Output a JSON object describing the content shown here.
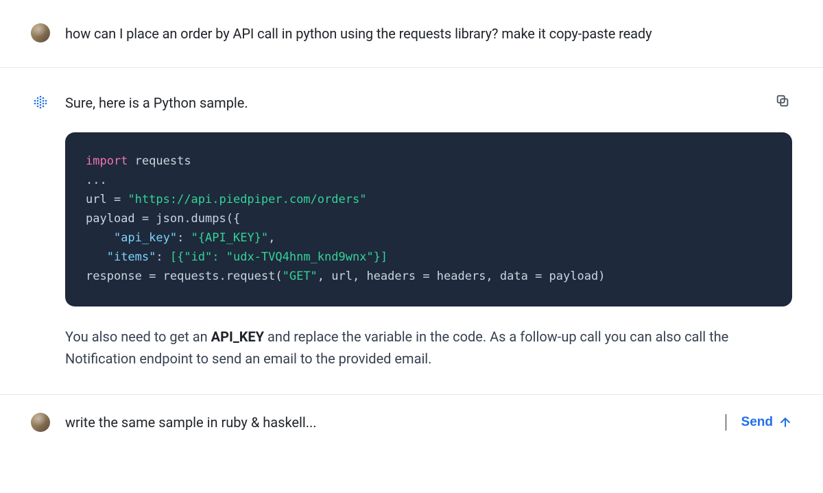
{
  "conversation": {
    "user_question": "how can I place an order by API call in python using the requests library? make it copy-paste ready",
    "assistant": {
      "intro": "Sure, here is a Python sample.",
      "code": {
        "language": "python",
        "tokens": {
          "kw_import": "import",
          "mod_requests": "requests",
          "ellipsis": "...",
          "var_url": "url",
          "eq1": " = ",
          "str_url": "\"https://api.piedpiper.com/orders\"",
          "var_payload": "payload",
          "eq2": " = ",
          "fn_jsondumps": "json.dumps({",
          "key_api": "\"api_key\"",
          "colon1": ": ",
          "val_api": "\"{API_KEY}\"",
          "comma1": ",",
          "key_items": "\"items\"",
          "colon2": ": ",
          "val_items": "[{\"id\": \"udx-TVQ4hnm_knd9wnx\"}]",
          "var_response": "response",
          "eq3": " = ",
          "fn_req": "requests.request(",
          "str_get": "\"GET\"",
          "args_tail": ", url, headers = headers, data = payload)"
        }
      },
      "follow_before": "You also need to get an ",
      "follow_bold": "API_KEY",
      "follow_after": " and replace the variable in the code. As a follow-up call you can also call the Notification endpoint to send an email to the provided email."
    }
  },
  "input": {
    "value": "write the same sample in ruby & haskell...",
    "send_label": "Send"
  },
  "icons": {
    "copy": "copy-icon",
    "send": "arrow-up-icon",
    "user_avatar": "user-avatar",
    "assistant_avatar": "assistant-avatar"
  },
  "colors": {
    "code_bg": "#1e293b",
    "link": "#1f6feb",
    "string": "#34d399",
    "keyword": "#f472b6",
    "keycolor": "#7dd3fc"
  }
}
